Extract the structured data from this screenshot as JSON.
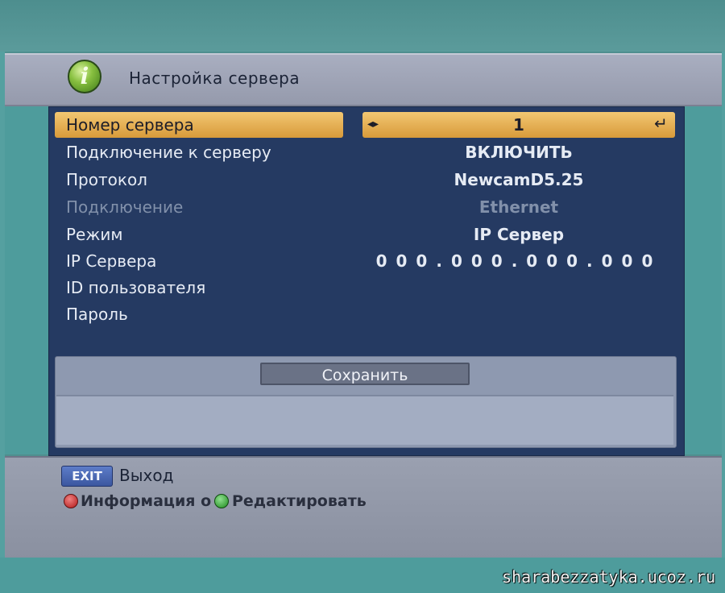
{
  "header": {
    "title": "Настройка сервера",
    "icon": "info-icon"
  },
  "settings": {
    "rows": [
      {
        "label": "Номер сервера",
        "value": "1"
      },
      {
        "label": "Подключение к серверу",
        "value": "ВКЛЮЧИТЬ"
      },
      {
        "label": "Протокол",
        "value": "NewcamD5.25"
      },
      {
        "label": "Подключение",
        "value": "Ethernet"
      },
      {
        "label": "Режим",
        "value": "IP Сервер"
      },
      {
        "label": "IP Сервера",
        "value": "000.000.000.000"
      },
      {
        "label": "ID пользователя",
        "value": ""
      },
      {
        "label": "Пароль",
        "value": ""
      }
    ]
  },
  "save_button": {
    "label": "Сохранить"
  },
  "footer": {
    "exit_key": "EXIT",
    "exit_label": "Выход",
    "info_label": "Информация о (",
    "edit_label": "Редактировать"
  },
  "watermark": "sharabezzatyka.ucoz.ru",
  "colors": {
    "highlight": "#e6b45a",
    "panel": "#253a62",
    "frame": "#4e9c9c"
  }
}
